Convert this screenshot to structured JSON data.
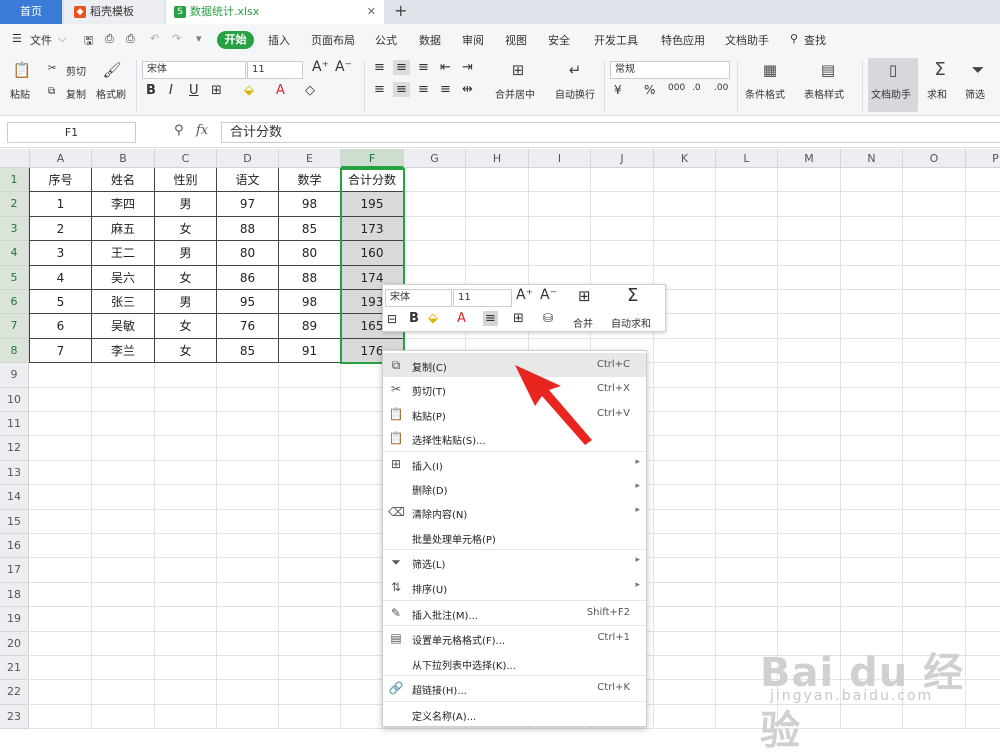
{
  "tabs": {
    "home": "首页",
    "template": "稻壳模板",
    "file": "数据统计.xlsx"
  },
  "menu": {
    "file": "文件",
    "start": "开始",
    "items": [
      "插入",
      "页面布局",
      "公式",
      "数据",
      "审阅",
      "视图",
      "安全",
      "开发工具",
      "特色应用",
      "文档助手"
    ],
    "search": "查找"
  },
  "ribbon": {
    "paste": "粘贴",
    "cut": "剪切",
    "copy": "复制",
    "format_painter": "格式刷",
    "font_name": "宋体",
    "font_size": "11",
    "merge_center": "合并居中",
    "wrap_text": "自动换行",
    "number_format": "常规",
    "conditional_format": "条件格式",
    "table_style": "表格样式",
    "doc_assistant": "文档助手",
    "sum": "求和",
    "filter": "筛选"
  },
  "formula_bar": {
    "name_box": "F1",
    "fx": "fx",
    "content": "合计分数"
  },
  "columns": [
    "A",
    "B",
    "C",
    "D",
    "E",
    "F",
    "G",
    "H",
    "I",
    "J",
    "K",
    "L",
    "M",
    "N",
    "O",
    "P"
  ],
  "rows": [
    "1",
    "2",
    "3",
    "4",
    "5",
    "6",
    "7",
    "8",
    "9",
    "10",
    "11",
    "12",
    "13",
    "14",
    "15",
    "16",
    "17",
    "18",
    "19",
    "20",
    "21",
    "22",
    "23"
  ],
  "table": {
    "header": [
      "序号",
      "姓名",
      "性别",
      "语文",
      "数学",
      "合计分数"
    ],
    "data": [
      [
        "1",
        "李四",
        "男",
        "97",
        "98",
        "195"
      ],
      [
        "2",
        "麻五",
        "女",
        "88",
        "85",
        "173"
      ],
      [
        "3",
        "王二",
        "男",
        "80",
        "80",
        "160"
      ],
      [
        "4",
        "吴六",
        "女",
        "86",
        "88",
        "174"
      ],
      [
        "5",
        "张三",
        "男",
        "95",
        "98",
        "193"
      ],
      [
        "6",
        "吴敏",
        "女",
        "76",
        "89",
        "165"
      ],
      [
        "7",
        "李兰",
        "女",
        "85",
        "91",
        "176"
      ]
    ]
  },
  "mini_toolbar": {
    "font": "宋体",
    "size": "11",
    "merge": "合并",
    "autosum": "自动求和"
  },
  "context_menu": [
    {
      "label": "复制(C)",
      "shortcut": "Ctrl+C",
      "icon": "copy-icon"
    },
    {
      "label": "剪切(T)",
      "shortcut": "Ctrl+X",
      "icon": "scissors-icon"
    },
    {
      "label": "粘贴(P)",
      "shortcut": "Ctrl+V",
      "icon": "paste-icon"
    },
    {
      "label": "选择性粘贴(S)...",
      "shortcut": "",
      "icon": "paste-special-icon"
    },
    {
      "label": "插入(I)",
      "shortcut": "",
      "icon": "insert-icon"
    },
    {
      "label": "删除(D)",
      "shortcut": "",
      "icon": ""
    },
    {
      "label": "清除内容(N)",
      "shortcut": "",
      "icon": "eraser-icon"
    },
    {
      "label": "批量处理单元格(P)",
      "shortcut": "",
      "icon": ""
    },
    {
      "label": "筛选(L)",
      "shortcut": "",
      "icon": "filter-icon"
    },
    {
      "label": "排序(U)",
      "shortcut": "",
      "icon": "sort-icon"
    },
    {
      "label": "插入批注(M)...",
      "shortcut": "Shift+F2",
      "icon": "comment-icon"
    },
    {
      "label": "设置单元格格式(F)...",
      "shortcut": "Ctrl+1",
      "icon": "format-cells-icon"
    },
    {
      "label": "从下拉列表中选择(K)...",
      "shortcut": "",
      "icon": ""
    },
    {
      "label": "超链接(H)...",
      "shortcut": "Ctrl+K",
      "icon": "link-icon"
    },
    {
      "label": "定义名称(A)...",
      "shortcut": "",
      "icon": ""
    }
  ],
  "watermark": {
    "brand": "Bai du 经验",
    "url": "jingyan.baidu.com"
  },
  "colors": {
    "accent_green": "#27a243",
    "home_tab_blue": "#3a7bd5",
    "arrow_red": "#e8261f"
  }
}
